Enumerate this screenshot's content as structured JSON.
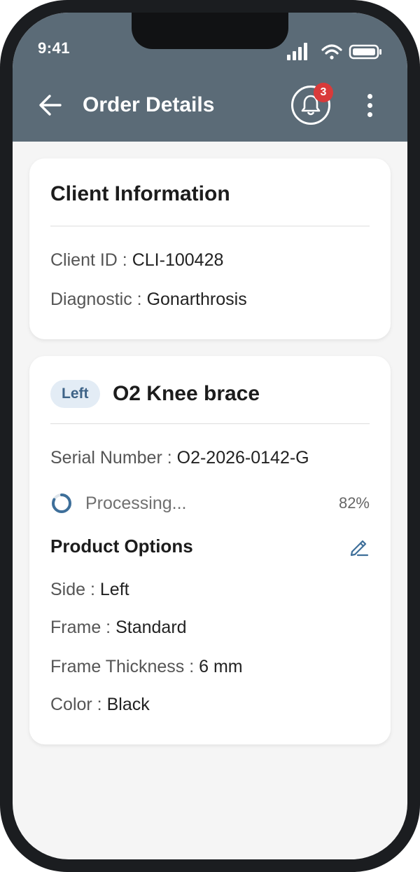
{
  "status_bar": {
    "time": "9:41"
  },
  "app_bar": {
    "title": "Order Details",
    "notifications_count": "3",
    "background": "#5b6b77",
    "icons": {
      "back": "back-arrow-icon",
      "bell": "bell-icon",
      "more": "more-vertical-icon"
    }
  },
  "client_card": {
    "heading": "Client Information",
    "client_id_label": "Client ID :",
    "client_id_value": "CLI-100428",
    "diagnostic_label": "Diagnostic :",
    "diagnostic_value": "Gonarthrosis"
  },
  "product_card": {
    "side_chip": "Left",
    "title": "O2 Knee brace",
    "serial_label": "Serial Number :",
    "serial_value": "O2-2026-0142-G",
    "processing_label": "Processing...",
    "processing_percent": "82%",
    "progress": 0.82,
    "accent": "#3e6f9a",
    "options": {
      "title": "Product Options",
      "edit_icon": "pencil-icon",
      "items": [
        {
          "label": "Side :",
          "value": "Left"
        },
        {
          "label": "Frame :",
          "value": "Standard"
        },
        {
          "label": "Frame Thickness :",
          "value": "6 mm"
        },
        {
          "label": "Color :",
          "value": "Black"
        }
      ]
    }
  }
}
